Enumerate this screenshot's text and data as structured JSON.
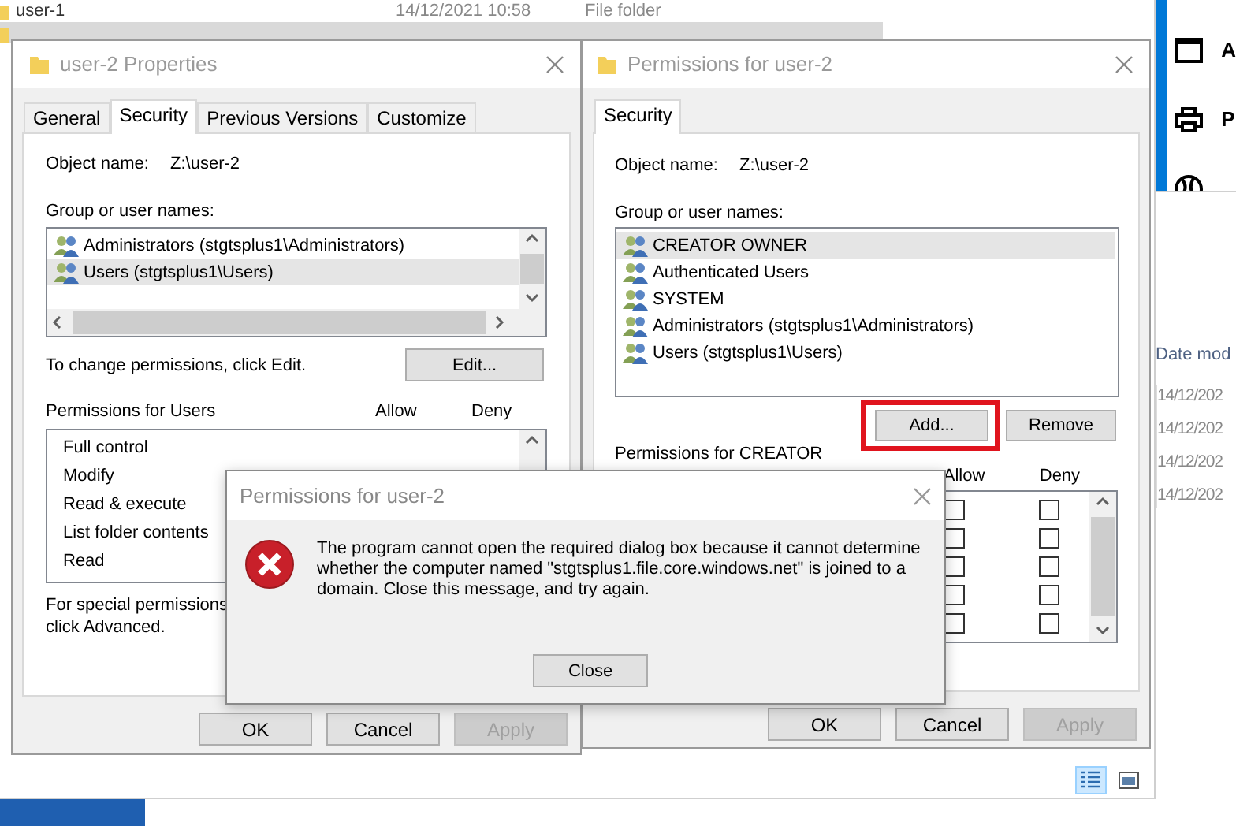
{
  "explorer": {
    "rows": [
      {
        "name": "user-1",
        "date_modified": "14/12/2021 10:58",
        "type": "File folder",
        "selected": false
      },
      {
        "selected": true
      }
    ],
    "side_panel": [
      {
        "kind": "window",
        "label": "A"
      },
      {
        "kind": "printer",
        "label": "P"
      },
      {
        "kind": "globe"
      }
    ],
    "date_column": {
      "header": "Date mod",
      "cells": [
        "14/12/202",
        "14/12/202",
        "14/12/202",
        "14/12/202"
      ]
    },
    "view_buttons": [
      {
        "kind": "details",
        "selected": true
      },
      {
        "kind": "preview",
        "selected": false
      }
    ]
  },
  "properties_dialog": {
    "title": "user-2 Properties",
    "tabs": [
      {
        "label": "General",
        "selected": false
      },
      {
        "label": "Security",
        "selected": true
      },
      {
        "label": "Previous Versions",
        "selected": false
      },
      {
        "label": "Customize",
        "selected": false
      }
    ],
    "object_label": "Object name:",
    "object_name": "Z:\\user-2",
    "group_label": "Group or user names:",
    "users": [
      {
        "name": "Administrators (stgtsplus1\\Administrators)",
        "selected": false
      },
      {
        "name": "Users (stgtsplus1\\Users)",
        "selected": true
      }
    ],
    "change_hint": "To change permissions, click Edit.",
    "edit_button": "Edit...",
    "permissions_label": "Permissions for Users",
    "allow_header": "Allow",
    "deny_header": "Deny",
    "permissions": [
      "Full control",
      "Modify",
      "Read & execute",
      "List folder contents",
      "Read"
    ],
    "special_lines": [
      "For special permissions",
      "click Advanced."
    ],
    "buttons": [
      {
        "label": "OK",
        "disabled": false
      },
      {
        "label": "Cancel",
        "disabled": false
      },
      {
        "label": "Apply",
        "disabled": true
      }
    ]
  },
  "permissions_dialog": {
    "title": "Permissions for user-2",
    "tabs": [
      {
        "label": "Security",
        "selected": true
      }
    ],
    "object_label": "Object name:",
    "object_name": "Z:\\user-2",
    "group_label": "Group or user names:",
    "users": [
      {
        "name": "CREATOR OWNER",
        "selected": true
      },
      {
        "name": "Authenticated Users",
        "selected": false
      },
      {
        "name": "SYSTEM",
        "selected": false
      },
      {
        "name": "Administrators (stgtsplus1\\Administrators)",
        "selected": false
      },
      {
        "name": "Users (stgtsplus1\\Users)",
        "selected": false
      }
    ],
    "add_button": {
      "label": "Add...",
      "highlighted": true
    },
    "remove_button": "Remove",
    "permissions_label": "Permissions for CREATOR",
    "allow_header": "Allow",
    "deny_header": "Deny",
    "checks": [
      {
        "allow": false,
        "deny": false
      },
      {
        "allow": false,
        "deny": false
      },
      {
        "allow": false,
        "deny": false
      },
      {
        "allow": false,
        "deny": false
      },
      {
        "allow": false,
        "deny": false
      }
    ],
    "buttons": [
      {
        "label": "OK",
        "disabled": false
      },
      {
        "label": "Cancel",
        "disabled": false
      },
      {
        "label": "Apply",
        "disabled": true
      }
    ]
  },
  "message_box": {
    "title": "Permissions for user-2",
    "kind": "error",
    "message": "The program cannot open the required dialog box because it cannot determine whether the computer named \"stgtsplus1.file.core.windows.net\" is joined to a domain. Close this message, and try again.",
    "button": "Close"
  }
}
